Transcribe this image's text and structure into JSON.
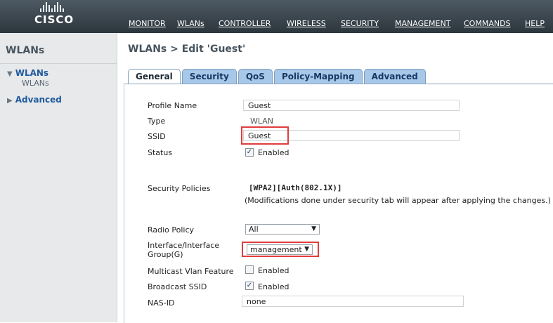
{
  "brand": {
    "logo_text": "CISCO"
  },
  "nav": [
    "MONITOR",
    "WLANs",
    "CONTROLLER",
    "WIRELESS",
    "SECURITY",
    "MANAGEMENT",
    "COMMANDS",
    "HELP"
  ],
  "sidebar": {
    "title": "WLANs",
    "groups": [
      {
        "label": "WLANs",
        "expanded": true,
        "children": [
          "WLANs"
        ]
      },
      {
        "label": "Advanced",
        "expanded": false
      }
    ]
  },
  "page": {
    "title": "WLANs > Edit  'Guest'"
  },
  "tabs": [
    "General",
    "Security",
    "QoS",
    "Policy-Mapping",
    "Advanced"
  ],
  "active_tab": "General",
  "form": {
    "profile_name": {
      "label": "Profile Name",
      "value": "Guest"
    },
    "type": {
      "label": "Type",
      "value": "WLAN"
    },
    "ssid": {
      "label": "SSID",
      "value": "Guest"
    },
    "status": {
      "label": "Status",
      "checkbox_label": "Enabled",
      "checked": true
    },
    "security_policies": {
      "label": "Security Policies",
      "value": "[WPA2][Auth(802.1X)]",
      "note": "(Modifications done under security tab will appear after applying the changes.)"
    },
    "radio_policy": {
      "label": "Radio Policy",
      "value": "All"
    },
    "interface_group": {
      "label_line1": "Interface/Interface",
      "label_line2": "Group(G)",
      "value": "management"
    },
    "multicast_vlan": {
      "label": "Multicast Vlan Feature",
      "checkbox_label": "Enabled",
      "checked": false
    },
    "broadcast_ssid": {
      "label": "Broadcast SSID",
      "checkbox_label": "Enabled",
      "checked": true
    },
    "nas_id": {
      "label": "NAS-ID",
      "value": "none"
    }
  },
  "colors": {
    "header": "#3a454e",
    "tab": "#a8c8ea",
    "highlight": "#e23c3c",
    "sidebar_link": "#1f5a9e"
  }
}
